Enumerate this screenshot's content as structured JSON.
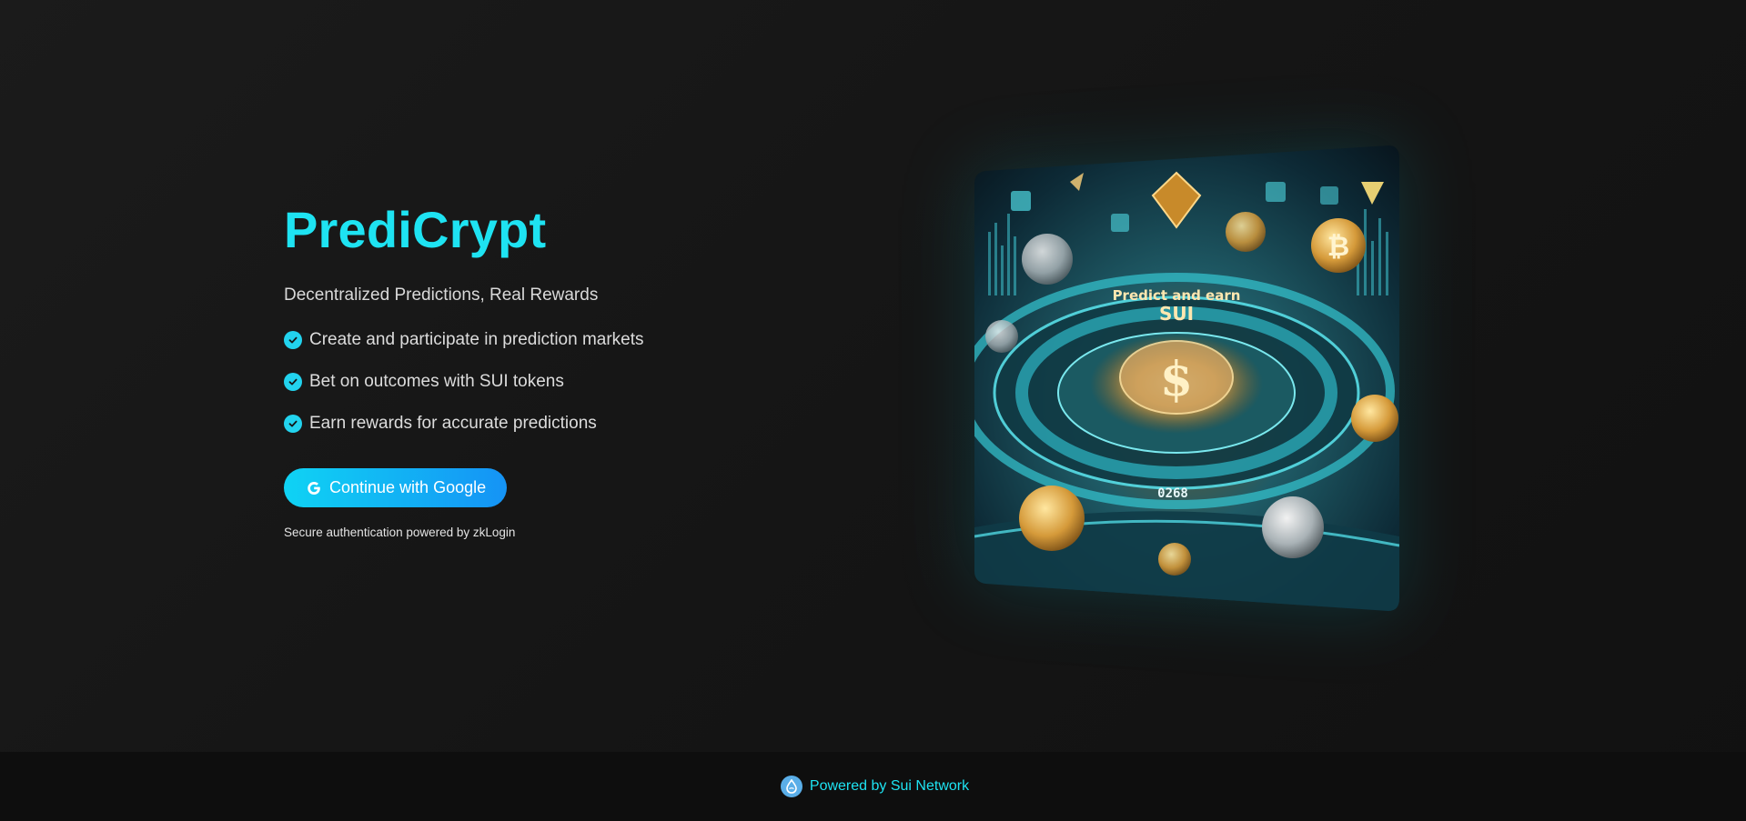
{
  "brand": {
    "title": "PrediCrypt",
    "tagline": "Decentralized Predictions, Real Rewards"
  },
  "features": [
    {
      "label": "Create and participate in prediction markets",
      "icon": "check-circle-icon"
    },
    {
      "label": "Bet on outcomes with SUI tokens",
      "icon": "check-circle-icon"
    },
    {
      "label": "Earn rewards for accurate predictions",
      "icon": "check-circle-icon"
    }
  ],
  "login": {
    "button_label": "Continue with Google",
    "button_icon": "google-icon",
    "note": "Secure authentication powered by zkLogin"
  },
  "hero_image": {
    "caption_line1": "Predict and earn",
    "caption_line2": "SUI",
    "counter": "0268",
    "symbols": [
      "$",
      "₿"
    ]
  },
  "footer": {
    "text": "Powered by Sui Network",
    "icon": "sui-drop-icon"
  },
  "colors": {
    "accent": "#1ee3f2",
    "button_start": "#0fd3f4",
    "button_end": "#1593f5",
    "background": "#161616",
    "footer_bg": "#0e0e0e"
  }
}
